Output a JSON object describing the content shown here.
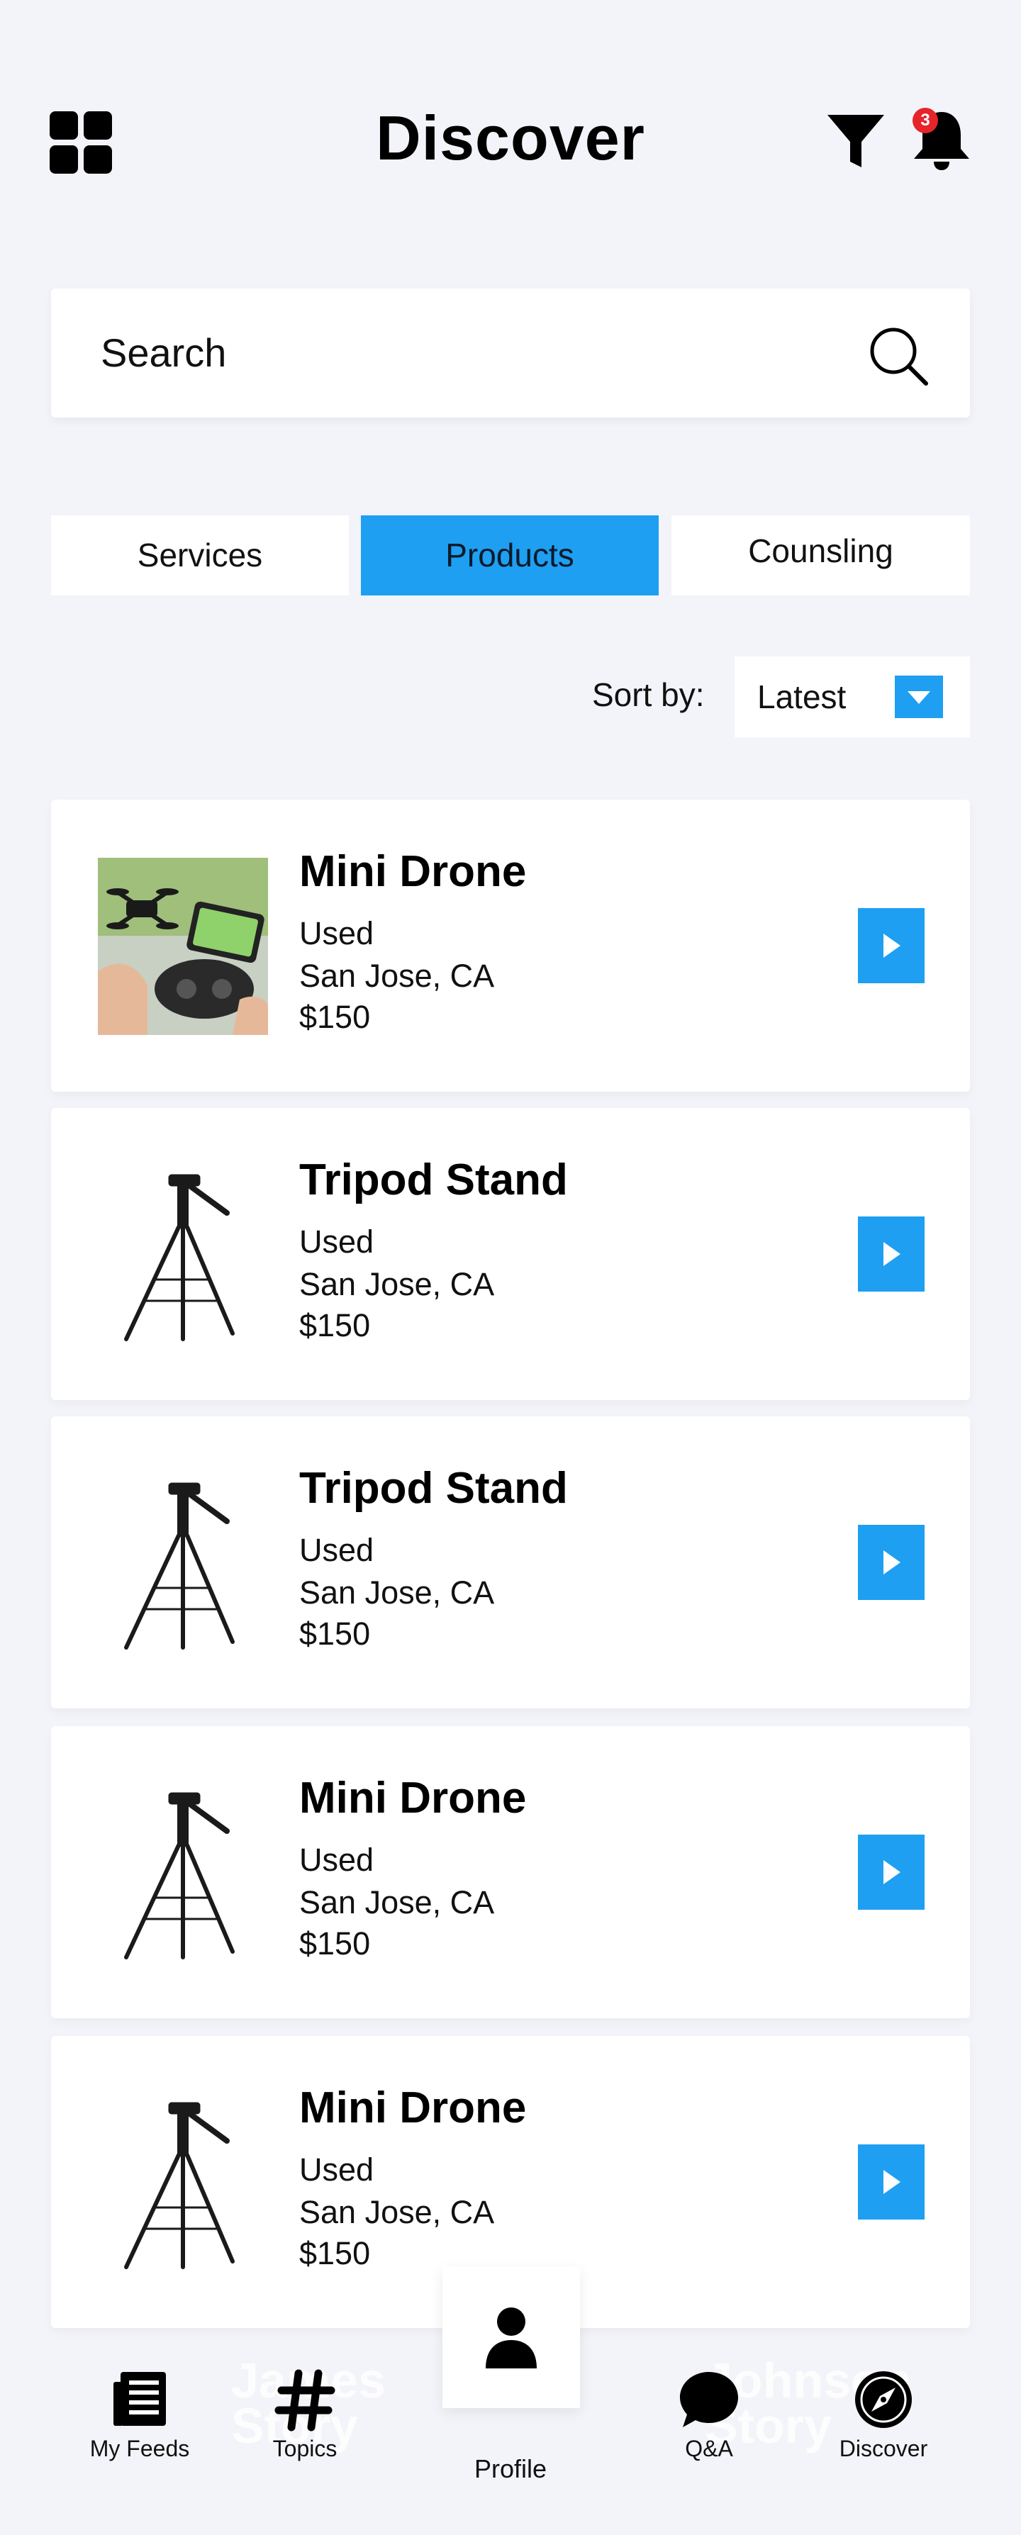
{
  "header": {
    "title": "Discover",
    "notification_count": "3",
    "accent": "#1e9ff2"
  },
  "search": {
    "text": "Search"
  },
  "tabs": [
    {
      "label": "Services",
      "active": false
    },
    {
      "label": "Products",
      "active": true
    },
    {
      "label": "Counsling",
      "active": false
    }
  ],
  "sort": {
    "label": "Sort by:",
    "value": "Latest"
  },
  "cards": [
    {
      "title": "Mini Drone",
      "condition": "Used",
      "location": "San Jose, CA",
      "price": "$150",
      "image": "drone-photo"
    },
    {
      "title": "Tripod Stand",
      "condition": "Used",
      "location": "San Jose, CA",
      "price": "$150",
      "image": "tripod-photo"
    },
    {
      "title": "Tripod Stand",
      "condition": "Used",
      "location": "San Jose, CA",
      "price": "$150",
      "image": "tripod-photo"
    },
    {
      "title": "Mini Drone",
      "condition": "Used",
      "location": "San Jose, CA",
      "price": "$150",
      "image": "tripod-photo"
    },
    {
      "title": "Mini Drone",
      "condition": "Used",
      "location": "San Jose, CA",
      "price": "$150",
      "image": "tripod-photo"
    }
  ],
  "bottom_nav": {
    "ghost_left": [
      "James",
      "Story"
    ],
    "ghost_right": [
      "Johnson",
      "Story"
    ],
    "items": [
      {
        "label": "My Feeds",
        "icon": "feed-icon"
      },
      {
        "label": "Topics",
        "icon": "hashtag-icon"
      },
      {
        "label": "Profile",
        "icon": "person-icon"
      },
      {
        "label": "Q&A",
        "icon": "chat-bubble-icon"
      },
      {
        "label": "Discover",
        "icon": "compass-icon"
      }
    ]
  }
}
